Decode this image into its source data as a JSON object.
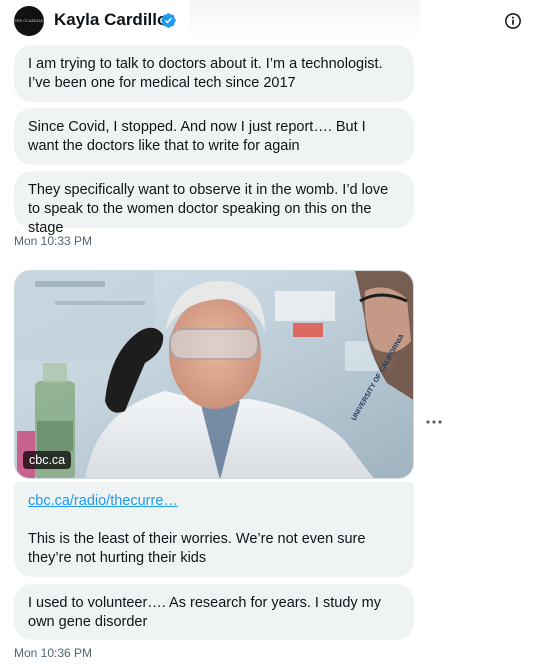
{
  "header": {
    "avatar_text": "THE GUARDIAN",
    "name": "Kayla Cardillo",
    "verified_icon": "verified-badge-icon",
    "info_icon": "info-circle-icon"
  },
  "messages": [
    {
      "text": "I am trying to talk to doctors about it. I’m a technologist. I’ve been one for medical tech since 2017"
    },
    {
      "text": "Since Covid, I stopped. And now I just report…. But I want the doctors like that to write for again"
    },
    {
      "text": "They specifically want to observe it in the womb. I’d love to speak to the women doctor speaking on this on the stage"
    }
  ],
  "timestamp_1": "Mon 10:33 PM",
  "link_card": {
    "domain": "cbc.ca",
    "coat_text": "UNIVERSITY OF CALIFORNIA",
    "link_text": "cbc.ca/radio/thecurre…",
    "message": "This is the least of their worries. We’re not even sure they’re not hurting their kids"
  },
  "message_last": {
    "text": "I used to volunteer…. As research for years. I study my own gene disorder"
  },
  "timestamp_2": "Mon 10:36 PM",
  "more_icon": "more-horizontal-icon",
  "colors": {
    "accent": "#1d9bf0",
    "bubble": "#eff3f4",
    "text": "#0f1419",
    "muted": "#536471"
  }
}
